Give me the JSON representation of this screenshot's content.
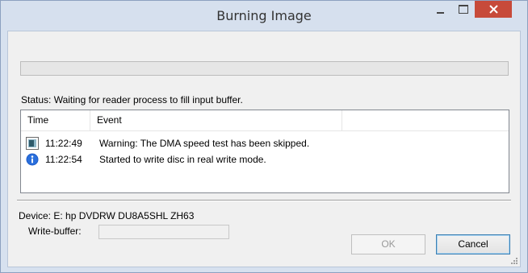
{
  "window": {
    "title": "Burning Image"
  },
  "status": {
    "text": "Status: Waiting for reader process to fill input buffer."
  },
  "progress": {
    "value": 0
  },
  "log": {
    "columns": [
      "Time",
      "Event"
    ],
    "rows": [
      {
        "icon": "warning-icon",
        "time": "11:22:49",
        "message": "Warning: The DMA speed test has been skipped."
      },
      {
        "icon": "info-icon",
        "time": "11:22:54",
        "message": "Started to write disc in real write mode."
      }
    ]
  },
  "device": {
    "text": "Device: E: hp DVDRW  DU8A5SHL ZH63"
  },
  "write_buffer": {
    "label": "Write-buffer:",
    "value": ""
  },
  "buttons": {
    "ok": "OK",
    "cancel": "Cancel"
  },
  "colors": {
    "close_button": "#c74a3a",
    "title_bar": "#d6e0ee",
    "cancel_focus_border": "#3c7fb1"
  }
}
